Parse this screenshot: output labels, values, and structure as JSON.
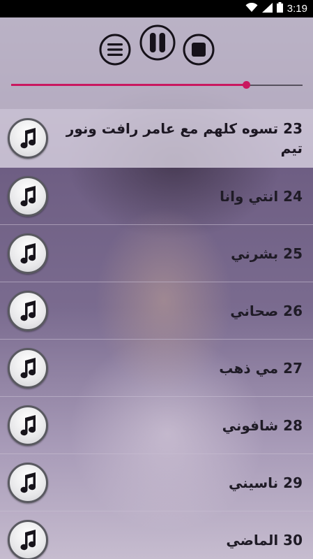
{
  "status_bar": {
    "time": "3:19",
    "icons": [
      "wifi-icon",
      "signal-icon",
      "battery-icon"
    ]
  },
  "player": {
    "controls": [
      "menu-icon",
      "pause-icon",
      "stop-icon"
    ],
    "seek_progress": 0.806,
    "accent_color": "#c9185f"
  },
  "songs": [
    {
      "title": "23 تسوه كلهم مع عامر رافت ونور تيم",
      "icon": "music-note-icon",
      "active": true
    },
    {
      "title": "24 انتي وانا",
      "icon": "music-note-icon"
    },
    {
      "title": "25 بشرني",
      "icon": "music-note-icon"
    },
    {
      "title": "26 صحاني",
      "icon": "music-note-icon"
    },
    {
      "title": "27 مي ذهب",
      "icon": "music-note-icon"
    },
    {
      "title": "28 شافوني",
      "icon": "music-note-icon"
    },
    {
      "title": "29 ناسيني",
      "icon": "music-note-icon"
    },
    {
      "title": "30 الماضي",
      "icon": "music-note-icon"
    }
  ]
}
